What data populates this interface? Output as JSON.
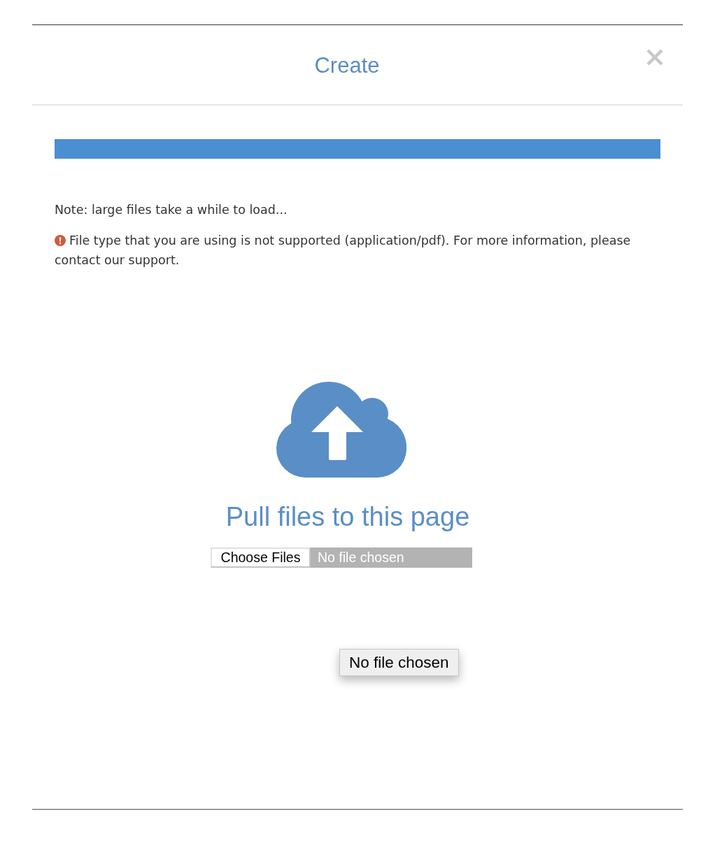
{
  "dialog": {
    "title": "Create"
  },
  "progress": {
    "level": 1
  },
  "messages": [
    {
      "kind": "note",
      "text": "Note: large files take a while to load..."
    },
    {
      "kind": "error",
      "text": "File type that you are using is not supported (application/pdf). For more information, please contact our support."
    }
  ],
  "dropzone": {
    "heading": "Pull files to this page",
    "file_input": {
      "button": "Choose Files",
      "status": "No file chosen"
    }
  },
  "tooltip": {
    "text": "No file chosen"
  }
}
